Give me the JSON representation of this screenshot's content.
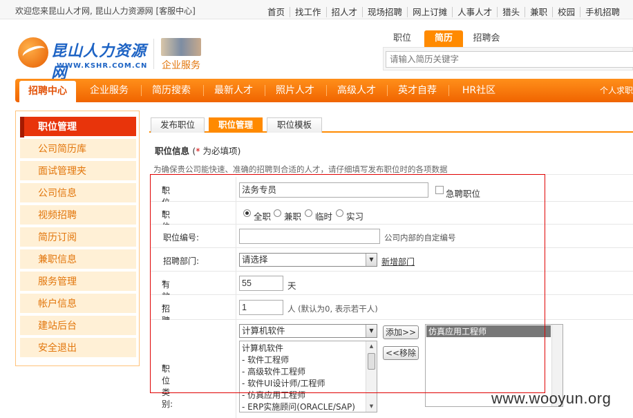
{
  "topbar": {
    "welcome": "欢迎您来昆山人才网, 昆山人力资源网",
    "service": "[客服中心]",
    "links": [
      "首页",
      "找工作",
      "招人才",
      "现场招聘",
      "网上订摊",
      "人事人才",
      "猎头",
      "兼职",
      "校园",
      "手机招聘"
    ]
  },
  "logo": {
    "name": "昆山人力资源网",
    "url": "WWW.KSHR.COM.CN",
    "service_label": "企业服务"
  },
  "search": {
    "tabs": [
      "职位",
      "简历",
      "招聘会"
    ],
    "active_tab": "简历",
    "placeholder": "请输入简历关键字"
  },
  "nav": {
    "items": [
      "招聘中心",
      "企业服务",
      "简历搜索",
      "最新人才",
      "照片人才",
      "高级人才",
      "英才自荐",
      "HR社区"
    ],
    "active": "招聘中心",
    "right": "个人求职"
  },
  "sidebar": {
    "items": [
      "职位管理",
      "公司简历库",
      "面试管理夹",
      "公司信息",
      "视频招聘",
      "简历订阅",
      "兼职信息",
      "服务管理",
      "帐户信息",
      "建站后台",
      "安全退出"
    ],
    "active": "职位管理"
  },
  "content_tabs": {
    "items": [
      "发布职位",
      "职位管理",
      "职位模板"
    ],
    "active": "职位管理"
  },
  "section": {
    "title": "职位信息",
    "required_open": "(",
    "required_star": "*",
    "required_text": " 为必填项)",
    "hint": "为确保贵公司能快速、准确的招聘到合适的人才，请仔细填写发布职位时的各项数据"
  },
  "form": {
    "job_name": {
      "label": "职位名称:",
      "value": "法务专员",
      "urgent_label": "急聘职位",
      "urgent_checked": false
    },
    "job_type": {
      "label": "职位性质:",
      "options": [
        "全职",
        "兼职",
        "临时",
        "实习"
      ],
      "selected": "全职"
    },
    "job_code": {
      "label": "职位编号:",
      "value": "",
      "note": "公司内部的自定编号"
    },
    "department": {
      "label": "招聘部门:",
      "selected": "请选择",
      "add_link": "新增部门"
    },
    "validity": {
      "label": "有效期限:",
      "value": "55",
      "unit": "天"
    },
    "headcount": {
      "label": "招聘人数:",
      "value": "1",
      "note": "人 (默认为0, 表示若干人)"
    },
    "category": {
      "label": "职位类别:",
      "selected": "计算机软件",
      "list": [
        "计算机软件",
        "- 软件工程师",
        "- 高级软件工程师",
        "- 软件UI设计师/工程师",
        "- 仿真应用工程师",
        "- ERP实施顾问(ORACLE/SAP)"
      ],
      "add_button": "添加>>",
      "remove_button": "<<移除",
      "chosen": [
        "仿真应用工程师"
      ]
    }
  },
  "watermark": "www.wooyun.org",
  "colors": {
    "accent": "#ff8a00",
    "active_red": "#e8340b",
    "highlight_box": "#e00000"
  }
}
